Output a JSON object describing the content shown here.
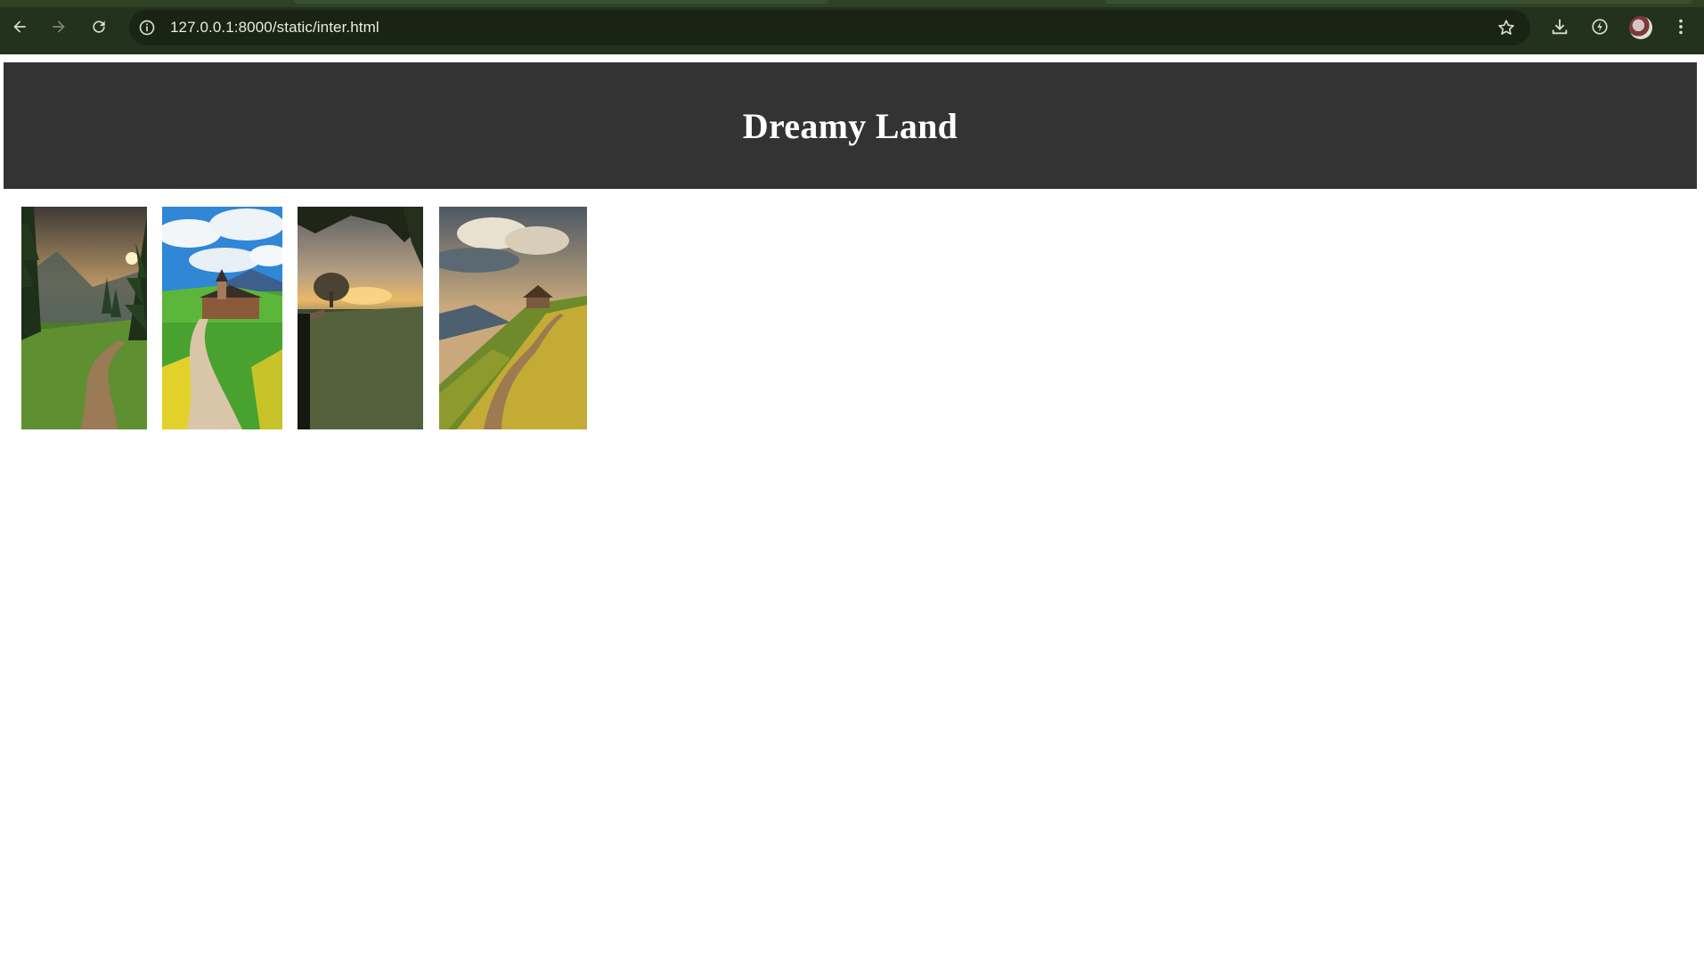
{
  "browser": {
    "url": "127.0.0.1:8000/static/inter.html",
    "icons": {
      "back": "arrow-left-icon",
      "forward": "arrow-right-icon",
      "reload": "reload-icon",
      "info": "info-icon",
      "bookmark": "star-icon",
      "download": "download-icon",
      "performance": "lightning-circle-icon",
      "menu": "kebab-menu-icon"
    },
    "colors": {
      "toolbar": "#23321c",
      "omnibox": "#1a2415",
      "icon": "#d7ddd0"
    }
  },
  "page": {
    "title": "Dreamy Land",
    "header_bg": "#333333",
    "gallery": [
      {
        "name": "forest-path-sunset"
      },
      {
        "name": "church-meadow-path"
      },
      {
        "name": "misty-field-sunrise"
      },
      {
        "name": "hillside-cottage-path"
      }
    ]
  }
}
